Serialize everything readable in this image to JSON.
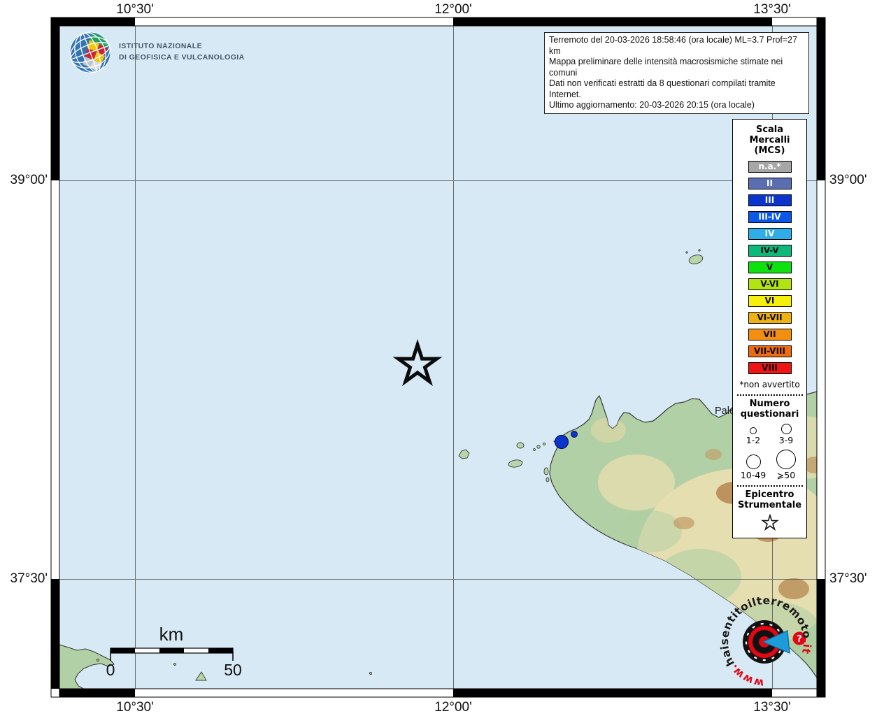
{
  "ingv": {
    "line1": "ISTITUTO NAZIONALE",
    "line2": "DI GEOFISICA E VULCANOLOGIA"
  },
  "info_box": {
    "lines": [
      "Terremoto del 20-03-2026 18:58:46 (ora locale) ML=3.7 Prof=27 km",
      "Mappa preliminare delle intensità macrosismiche stimate nei comuni",
      "Dati non verificati estratti da 8 questionari compilati tramite Internet.",
      "Ultimo aggiornamento: 20-03-2026 20:15 (ora locale)"
    ]
  },
  "map": {
    "axis": {
      "top": [
        "10°30'",
        "12°00'",
        "13°30'"
      ],
      "bottom": [
        "10°30'",
        "12°00'",
        "13°30'"
      ],
      "left": [
        "39°00'",
        "37°30'"
      ],
      "right": [
        "39°00'",
        "37°30'"
      ]
    },
    "place_labels": {
      "palermo": "Palermo"
    },
    "scale_bar": {
      "unit": "km",
      "zero": "0",
      "fifty": "50"
    },
    "sea_color": "#d7e9f5",
    "land_color": "#b2d0a5",
    "epicenter": {
      "symbol": "star"
    },
    "intensity_points": [
      {
        "color": "#0b34cc",
        "size": "large"
      },
      {
        "color": "#0b34cc",
        "size": "small"
      }
    ]
  },
  "legend": {
    "title_lines": [
      "Scala",
      "Mercalli",
      "(MCS)"
    ],
    "swatches": [
      {
        "label": "n.a.*",
        "color": "#a6a6a6",
        "text_color": "#ffffff"
      },
      {
        "label": "II",
        "color": "#5b6fb0",
        "text_color": "#ffffff"
      },
      {
        "label": "III",
        "color": "#0b34cc",
        "text_color": "#ffffff"
      },
      {
        "label": "III-IV",
        "color": "#0a57e8",
        "text_color": "#ffffff"
      },
      {
        "label": "IV",
        "color": "#2fade8",
        "text_color": "#ffffff"
      },
      {
        "label": "IV-V",
        "color": "#0cb87a",
        "text_color": "#0a0a0a"
      },
      {
        "label": "V",
        "color": "#0fe00f",
        "text_color": "#0a0a0a"
      },
      {
        "label": "V-VI",
        "color": "#b2e414",
        "text_color": "#0a0a0a"
      },
      {
        "label": "VI",
        "color": "#f4f00c",
        "text_color": "#0a0a0a"
      },
      {
        "label": "VI-VII",
        "color": "#edb112",
        "text_color": "#0a0a0a"
      },
      {
        "label": "VII",
        "color": "#f28f10",
        "text_color": "#0a0a0a"
      },
      {
        "label": "VII-VIII",
        "color": "#ef6b10",
        "text_color": "#0a0a0a"
      },
      {
        "label": "VIII",
        "color": "#ed1515",
        "text_color": "#0a0a0a"
      }
    ],
    "footnote": "*non avvertito",
    "questionnaires": {
      "title_lines": [
        "Numero",
        "questionari"
      ],
      "sizes": [
        {
          "label": "1-2"
        },
        {
          "label": "3-9"
        },
        {
          "label": "10-49"
        },
        {
          "label": "⩾50"
        }
      ]
    },
    "epicenter_section": {
      "title_lines": [
        "Epicentro",
        "Strumentale"
      ]
    }
  },
  "hsit": {
    "www": "www.",
    "domain": "haisentitoilterremoto",
    "tld": ".it",
    "question": "?"
  }
}
